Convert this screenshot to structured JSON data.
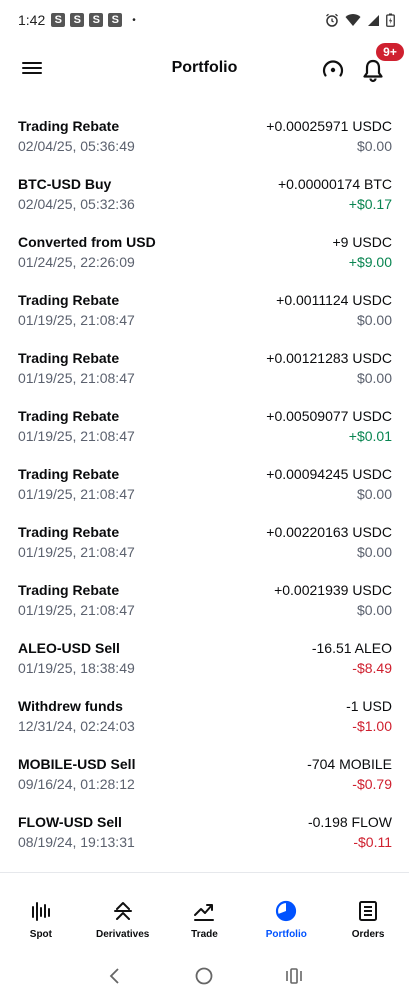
{
  "statusbar": {
    "time": "1:42",
    "notif_icons": [
      "S",
      "S",
      "S",
      "S"
    ],
    "dot": "•"
  },
  "header": {
    "title": "Portfolio",
    "badge": "9+"
  },
  "transactions": [
    {
      "name": "Trading Rebate",
      "date": "02/04/25, 05:36:49",
      "amount": "+0.00025971 USDC",
      "value": "$0.00",
      "tone": "neutral"
    },
    {
      "name": "BTC-USD Buy",
      "date": "02/04/25, 05:32:36",
      "amount": "+0.00000174 BTC",
      "value": "+$0.17",
      "tone": "pos"
    },
    {
      "name": "Converted from USD",
      "date": "01/24/25, 22:26:09",
      "amount": "+9 USDC",
      "value": "+$9.00",
      "tone": "pos"
    },
    {
      "name": "Trading Rebate",
      "date": "01/19/25, 21:08:47",
      "amount": "+0.0011124 USDC",
      "value": "$0.00",
      "tone": "neutral"
    },
    {
      "name": "Trading Rebate",
      "date": "01/19/25, 21:08:47",
      "amount": "+0.00121283 USDC",
      "value": "$0.00",
      "tone": "neutral"
    },
    {
      "name": "Trading Rebate",
      "date": "01/19/25, 21:08:47",
      "amount": "+0.00509077 USDC",
      "value": "+$0.01",
      "tone": "pos"
    },
    {
      "name": "Trading Rebate",
      "date": "01/19/25, 21:08:47",
      "amount": "+0.00094245 USDC",
      "value": "$0.00",
      "tone": "neutral"
    },
    {
      "name": "Trading Rebate",
      "date": "01/19/25, 21:08:47",
      "amount": "+0.00220163 USDC",
      "value": "$0.00",
      "tone": "neutral"
    },
    {
      "name": "Trading Rebate",
      "date": "01/19/25, 21:08:47",
      "amount": "+0.0021939 USDC",
      "value": "$0.00",
      "tone": "neutral"
    },
    {
      "name": "ALEO-USD Sell",
      "date": "01/19/25, 18:38:49",
      "amount": "-16.51 ALEO",
      "value": "-$8.49",
      "tone": "neg"
    },
    {
      "name": "Withdrew funds",
      "date": "12/31/24, 02:24:03",
      "amount": "-1 USD",
      "value": "-$1.00",
      "tone": "neg"
    },
    {
      "name": "MOBILE-USD Sell",
      "date": "09/16/24, 01:28:12",
      "amount": "-704 MOBILE",
      "value": "-$0.79",
      "tone": "neg"
    },
    {
      "name": "FLOW-USD Sell",
      "date": "08/19/24, 19:13:31",
      "amount": "-0.198 FLOW",
      "value": "-$0.11",
      "tone": "neg"
    }
  ],
  "bottomnav": {
    "items": [
      {
        "label": "Spot",
        "icon": "spot-bars-icon"
      },
      {
        "label": "Derivatives",
        "icon": "derivatives-icon"
      },
      {
        "label": "Trade",
        "icon": "trade-chart-icon"
      },
      {
        "label": "Portfolio",
        "icon": "portfolio-pie-icon"
      },
      {
        "label": "Orders",
        "icon": "orders-list-icon"
      }
    ],
    "active": "Portfolio"
  },
  "colors": {
    "accent": "#0052ff",
    "positive": "#098551",
    "negative": "#cf202f",
    "badge": "#cf202f"
  }
}
